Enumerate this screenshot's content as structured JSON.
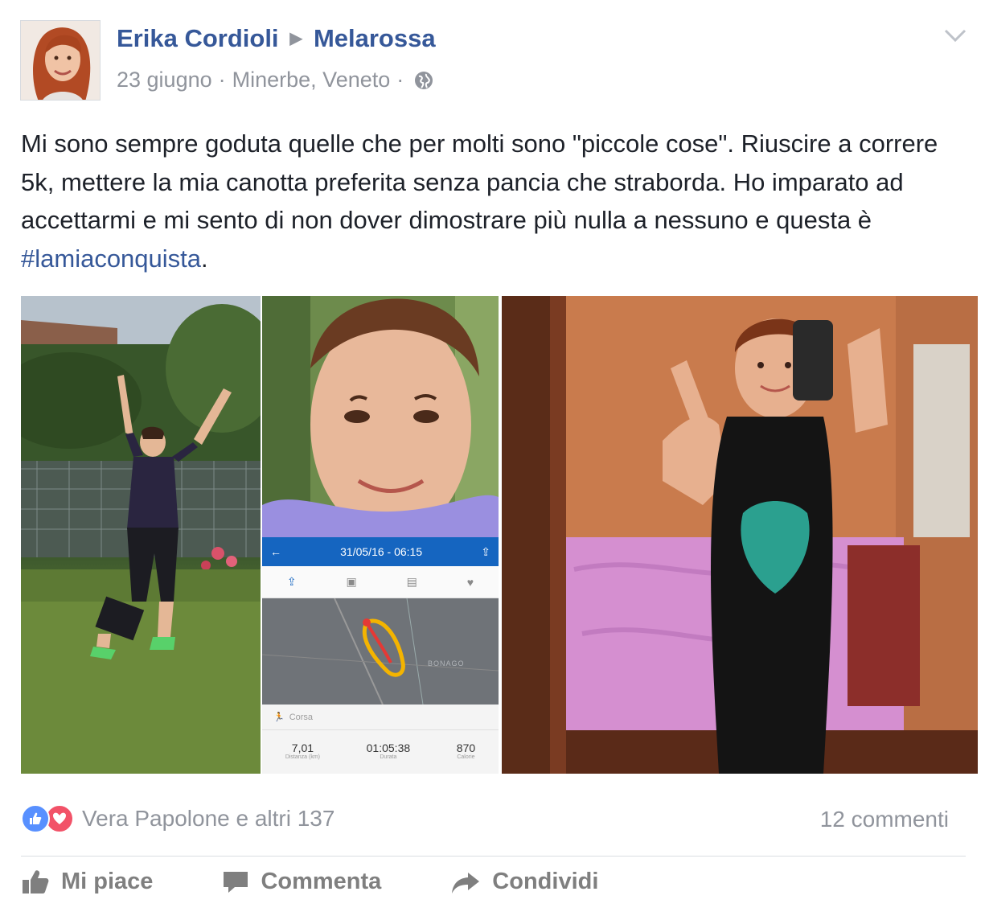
{
  "post": {
    "author": "Erika Cordioli",
    "group": "Melarossa",
    "date": "23 giugno",
    "location": "Minerbe, Veneto",
    "separator": "·",
    "text_before_hashtag": "Mi sono sempre goduta quelle che per molti sono \"piccole cose\". Riuscire a correre 5k, mettere la mia canotta preferita senza pancia che straborda. Ho imparato ad accettarmi e mi sento di non dover dimostrare più nulla a nessuno e questa è ",
    "hashtag": "#lamiaconquista",
    "text_after_hashtag": "."
  },
  "app_screen": {
    "header_date": "31/05/16 - 06:15",
    "activity_label": "Corsa",
    "map_label": "BONAGO",
    "stats": [
      {
        "value": "7,01",
        "label": "Distanza (km)"
      },
      {
        "value": "01:05:38",
        "label": "Durata"
      },
      {
        "value": "870",
        "label": "Calorie"
      }
    ]
  },
  "reactions": {
    "summary": "Vera Papolone e altri 137",
    "icons": [
      "like-icon",
      "love-icon"
    ]
  },
  "comments": {
    "count_label": "12 commenti"
  },
  "actions": {
    "like_label": "Mi piace",
    "comment_label": "Commenta",
    "share_label": "Condividi"
  },
  "colors": {
    "link_blue": "#365899",
    "meta_gray": "#90949c",
    "like_blue": "#5890ff",
    "love_red": "#f25268",
    "app_blue": "#1565c0"
  }
}
